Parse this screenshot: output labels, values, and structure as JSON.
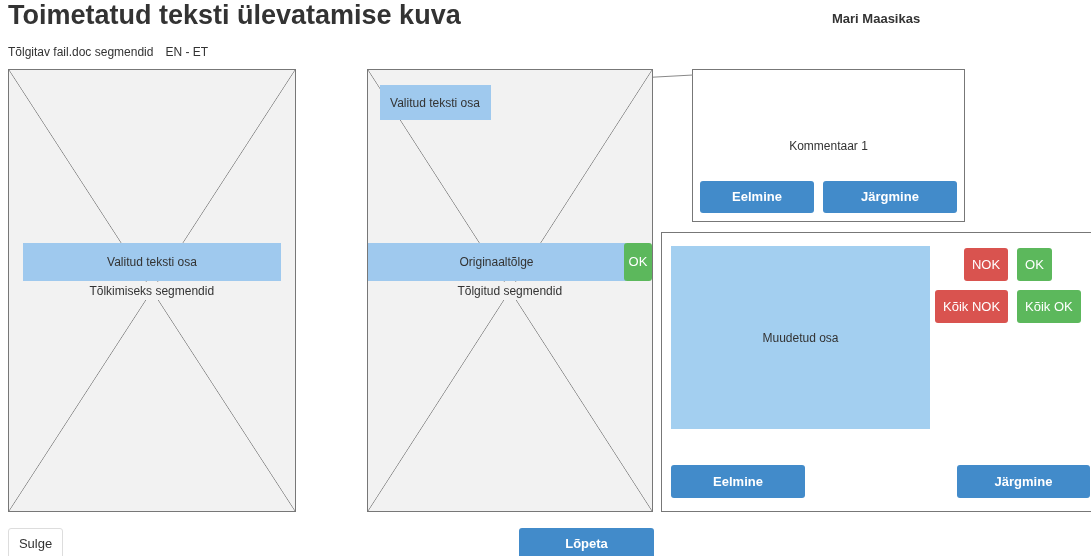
{
  "title": "Toimetatud teksti ülevatamise kuva",
  "user": "Mari Maasikas",
  "file_info": {
    "label": "Tõlgitav fail.doc segmendid",
    "languages": "EN - ET"
  },
  "source_panel": {
    "highlight": "Valitud teksti osa",
    "caption": "Tõlkimiseks segmendid"
  },
  "target_panel": {
    "selection": "Valitud teksti osa",
    "highlight": "Originaaltõlge",
    "ok_button": "OK",
    "caption": "Tõlgitud segmendid"
  },
  "comment": {
    "text": "Kommentaar 1",
    "buttons": [
      "Eelmine",
      "Järgmine"
    ]
  },
  "review": {
    "changed": "Muudetud osa",
    "actions": [
      {
        "label": "NOK",
        "kind": "reject"
      },
      {
        "label": "OK",
        "kind": "accept"
      },
      {
        "label": "Kõik NOK",
        "kind": "reject"
      },
      {
        "label": "Kõik OK",
        "kind": "accept"
      }
    ],
    "buttons": [
      "Eelmine",
      "Järgmine"
    ]
  },
  "footer": {
    "close": "Sulge",
    "finish": "Lõpeta"
  }
}
